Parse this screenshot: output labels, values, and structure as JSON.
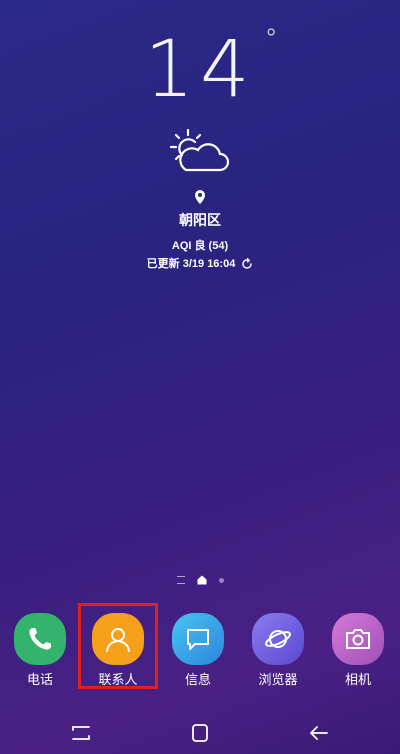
{
  "weather": {
    "temperature": "14",
    "degree_symbol": "°",
    "city": "朝阳区",
    "aqi": "AQI 良 (54)",
    "updated": "已更新 3/19 16:04",
    "icon": "partly-cloudy-icon"
  },
  "dock": {
    "apps": [
      {
        "label": "电话",
        "icon": "phone-icon",
        "color": "#33b36b"
      },
      {
        "label": "联系人",
        "icon": "contacts-icon",
        "color": "#f5a01a"
      },
      {
        "label": "信息",
        "icon": "message-icon",
        "color": "#3aa7e8"
      },
      {
        "label": "浏览器",
        "icon": "browser-icon",
        "color": "#6c5ce0"
      },
      {
        "label": "相机",
        "icon": "camera-icon",
        "color": "#c066c4"
      }
    ]
  },
  "highlight_color": "#e0201e",
  "navbar": {
    "buttons": [
      "recent-apps-icon",
      "home-icon",
      "back-icon"
    ]
  }
}
